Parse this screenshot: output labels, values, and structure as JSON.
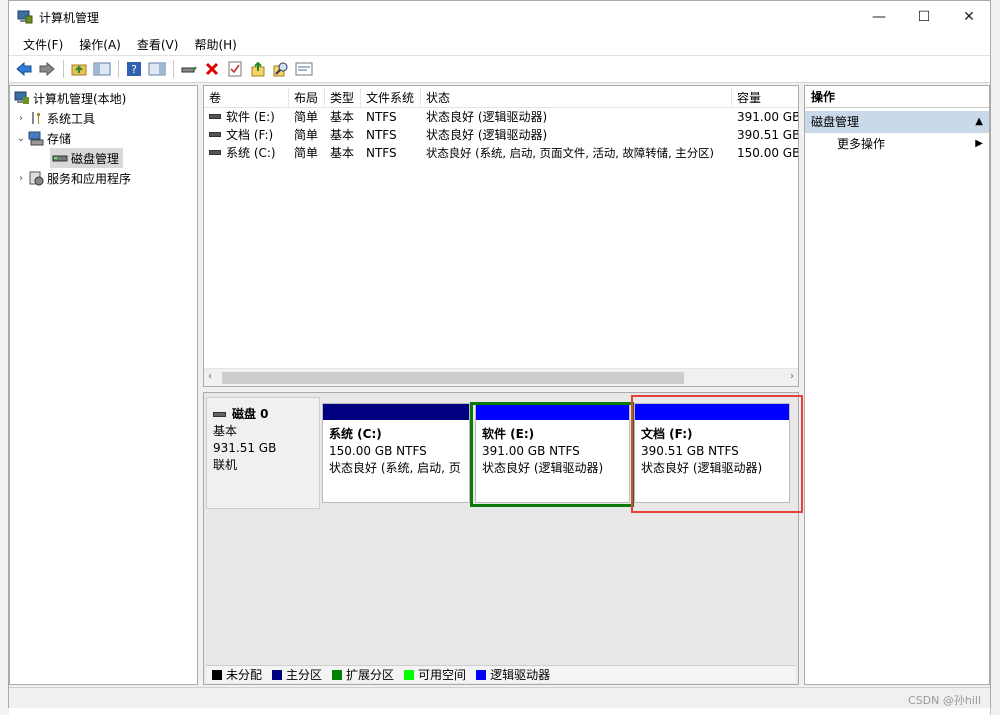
{
  "window": {
    "title": "计算机管理"
  },
  "menu": [
    "文件(F)",
    "操作(A)",
    "查看(V)",
    "帮助(H)"
  ],
  "toolbar": [
    {
      "icon": "back-arrow-icon"
    },
    {
      "icon": "forward-arrow-icon"
    },
    {
      "icon": "up-folder-icon"
    },
    {
      "icon": "show-hide-tree-icon"
    },
    {
      "icon": "help-icon"
    },
    {
      "icon": "action-pane-icon"
    },
    {
      "icon": "connect-drive-icon"
    },
    {
      "icon": "delete-icon"
    },
    {
      "icon": "properties-icon"
    },
    {
      "icon": "export-icon"
    },
    {
      "icon": "search-icon"
    },
    {
      "icon": "console-icon"
    }
  ],
  "tree": {
    "root": "计算机管理(本地)",
    "system_tools": "系统工具",
    "storage": "存储",
    "disk_management": "磁盘管理",
    "services_apps": "服务和应用程序"
  },
  "volumes": {
    "columns": [
      "卷",
      "布局",
      "类型",
      "文件系统",
      "状态",
      "容量"
    ],
    "rows": [
      [
        "软件 (E:)",
        "简单",
        "基本",
        "NTFS",
        "状态良好 (逻辑驱动器)",
        "391.00 GB"
      ],
      [
        "文档 (F:)",
        "简单",
        "基本",
        "NTFS",
        "状态良好 (逻辑驱动器)",
        "390.51 GB"
      ],
      [
        "系统 (C:)",
        "简单",
        "基本",
        "NTFS",
        "状态良好 (系统, 启动, 页面文件, 活动, 故障转储, 主分区)",
        "150.00 GB"
      ]
    ]
  },
  "disk": {
    "name": "磁盘 0",
    "type": "基本",
    "size": "931.51 GB",
    "status": "联机",
    "partitions": [
      {
        "title": "系统 (C:)",
        "size": "150.00 GB NTFS",
        "status": "状态良好 (系统, 启动, 页",
        "color": "#000080"
      },
      {
        "title": "软件 (E:)",
        "size": "391.00 GB NTFS",
        "status": "状态良好 (逻辑驱动器)",
        "color": "#0000ff"
      },
      {
        "title": "文档 (F:)",
        "size": "390.51 GB NTFS",
        "status": "状态良好 (逻辑驱动器)",
        "color": "#0000ff"
      }
    ]
  },
  "legend": [
    {
      "label": "未分配",
      "color": "#000000"
    },
    {
      "label": "主分区",
      "color": "#000080"
    },
    {
      "label": "扩展分区",
      "color": "#008000"
    },
    {
      "label": "可用空间",
      "color": "#00ff00"
    },
    {
      "label": "逻辑驱动器",
      "color": "#0000ff"
    }
  ],
  "actions": {
    "header": "操作",
    "section": "磁盘管理",
    "more": "更多操作"
  },
  "watermark": "CSDN @孙hill"
}
